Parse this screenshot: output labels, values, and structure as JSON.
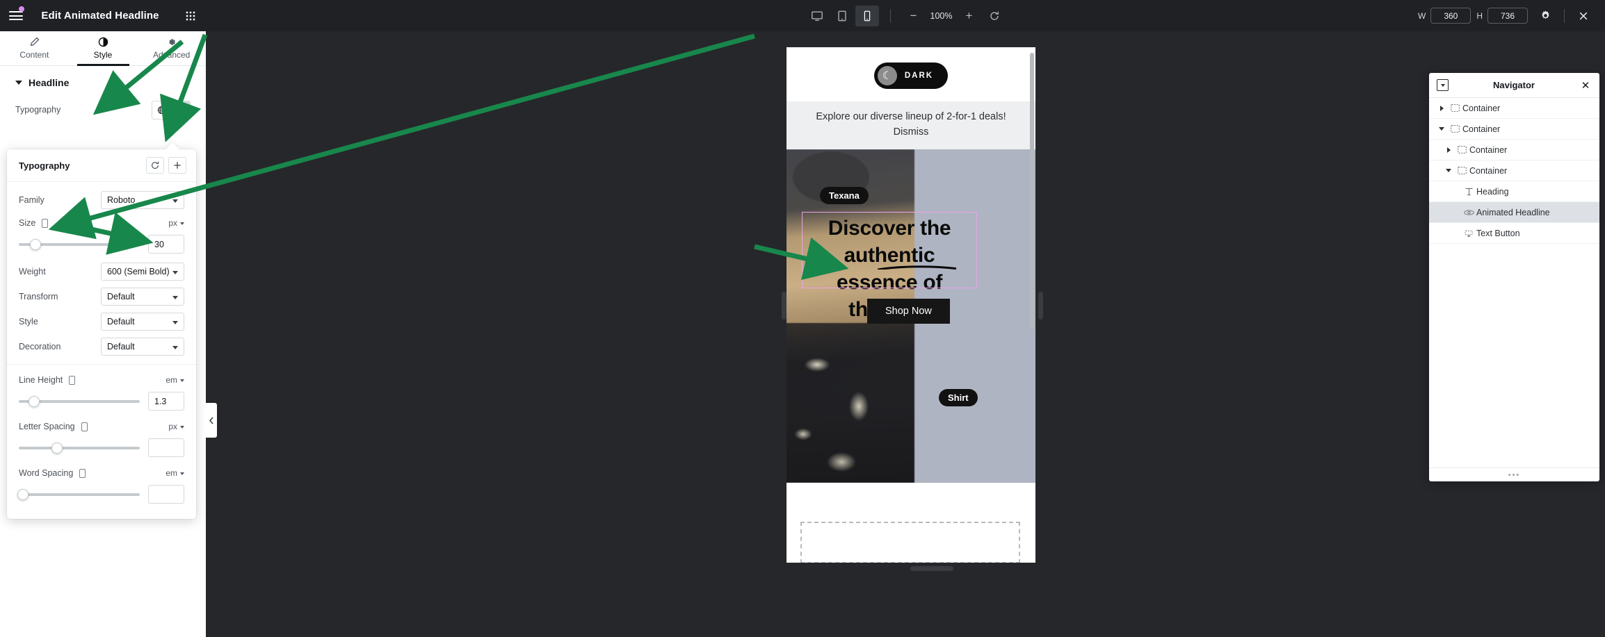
{
  "panel": {
    "title": "Edit Animated Headline",
    "tabs": [
      {
        "label": "Content",
        "icon": "pencil-icon",
        "active": false
      },
      {
        "label": "Style",
        "icon": "half-circle-contrast-icon",
        "active": true
      },
      {
        "label": "Advanced",
        "icon": "gear-icon",
        "active": false
      }
    ],
    "section": {
      "title": "Headline"
    },
    "typography_row": {
      "label": "Typography"
    }
  },
  "typography": {
    "title": "Typography",
    "reset_icon": "reset-icon",
    "add_icon": "plus-icon",
    "fields": {
      "family_label": "Family",
      "family_value": "Roboto",
      "size_label": "Size",
      "size_unit": "px",
      "size_value": "30",
      "weight_label": "Weight",
      "weight_value": "600 (Semi Bold)",
      "transform_label": "Transform",
      "transform_value": "Default",
      "style_label": "Style",
      "style_value": "Default",
      "decoration_label": "Decoration",
      "decoration_value": "Default",
      "line_height_label": "Line Height",
      "line_height_unit": "em",
      "line_height_value": "1.3",
      "letter_spacing_label": "Letter Spacing",
      "letter_spacing_unit": "px",
      "letter_spacing_value": "",
      "word_spacing_label": "Word Spacing",
      "word_spacing_unit": "em",
      "word_spacing_value": ""
    }
  },
  "topbar": {
    "devices": [
      {
        "name": "desktop-view",
        "active": false
      },
      {
        "name": "tablet-view",
        "active": false
      },
      {
        "name": "mobile-view",
        "active": true
      }
    ],
    "zoom_out": "−",
    "zoom_level": "100%",
    "zoom_in": "+",
    "reset_zoom_icon": "reset-icon",
    "width_label": "W",
    "width_value": "360",
    "height_label": "H",
    "height_value": "736",
    "settings_icon": "gear-icon",
    "close_icon": "close-x-icon"
  },
  "preview": {
    "dark_toggle": {
      "label": "DARK",
      "icon": "moon-icon"
    },
    "notice": "Explore our diverse lineup of 2-for-1 deals!",
    "dismiss": "Dismiss",
    "tag_texana": "Texana",
    "tag_shirt": "Shirt",
    "headline_line1": "Discover the",
    "headline_line2": "authentic essence of",
    "headline_line3": "the west",
    "shop_button": "Shop Now",
    "selection_color": "#eba3e8"
  },
  "navigator": {
    "title": "Navigator",
    "dock_icon": "dock-icon",
    "close_icon": "close-x-icon",
    "items": [
      {
        "label": "Container",
        "icon": "container-icon",
        "depth": 0,
        "toggle": "collapsed",
        "selected": false
      },
      {
        "label": "Container",
        "icon": "container-icon",
        "depth": 0,
        "toggle": "expanded",
        "selected": false
      },
      {
        "label": "Container",
        "icon": "container-icon",
        "depth": 1,
        "toggle": "collapsed",
        "selected": false
      },
      {
        "label": "Container",
        "icon": "container-icon",
        "depth": 1,
        "toggle": "expanded",
        "selected": false
      },
      {
        "label": "Heading",
        "icon": "heading-t-icon",
        "depth": 2,
        "toggle": "none",
        "selected": false
      },
      {
        "label": "Animated Headline",
        "icon": "animated-headline-icon",
        "depth": 2,
        "toggle": "none",
        "selected": true
      },
      {
        "label": "Text Button",
        "icon": "text-button-icon",
        "depth": 2,
        "toggle": "none",
        "selected": false
      }
    ],
    "resize_handle": "•••"
  },
  "annotations": {
    "arrow_color": "#18874b",
    "count": 3
  }
}
